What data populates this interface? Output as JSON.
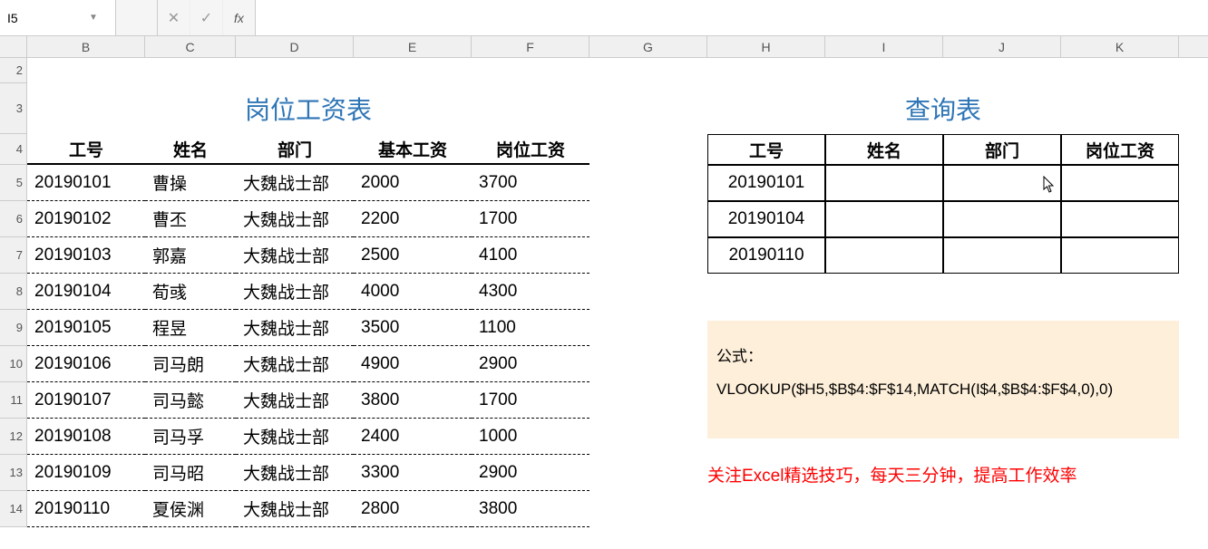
{
  "formula_bar": {
    "cell_ref": "I5",
    "cancel_icon": "✕",
    "confirm_icon": "✓",
    "fx_label": "fx",
    "formula_value": ""
  },
  "columns": [
    "B",
    "C",
    "D",
    "E",
    "F",
    "G",
    "H",
    "I",
    "J",
    "K"
  ],
  "col_widths": {
    "B": 130,
    "C": 100,
    "D": 130,
    "E": 130,
    "F": 130,
    "G": 130,
    "H": 130,
    "I": 130,
    "J": 130,
    "K": 130
  },
  "row_labels": [
    "2",
    "3",
    "4",
    "5",
    "6",
    "7",
    "8",
    "9",
    "10",
    "11",
    "12",
    "13",
    "14"
  ],
  "row_heights": {
    "2": 28,
    "3": 56,
    "4": 34,
    "5": 40,
    "6": 40,
    "7": 40,
    "8": 40,
    "9": 40,
    "10": 40,
    "11": 40,
    "12": 40,
    "13": 40,
    "14": 40
  },
  "left_table": {
    "title": "岗位工资表",
    "headers": [
      "工号",
      "姓名",
      "部门",
      "基本工资",
      "岗位工资"
    ],
    "rows": [
      {
        "id": "20190101",
        "name": "曹操",
        "dept": "大魏战士部",
        "base": "2000",
        "post": "3700"
      },
      {
        "id": "20190102",
        "name": "曹丕",
        "dept": "大魏战士部",
        "base": "2200",
        "post": "1700"
      },
      {
        "id": "20190103",
        "name": "郭嘉",
        "dept": "大魏战士部",
        "base": "2500",
        "post": "4100"
      },
      {
        "id": "20190104",
        "name": "荀彧",
        "dept": "大魏战士部",
        "base": "4000",
        "post": "4300"
      },
      {
        "id": "20190105",
        "name": "程昱",
        "dept": "大魏战士部",
        "base": "3500",
        "post": "1100"
      },
      {
        "id": "20190106",
        "name": "司马朗",
        "dept": "大魏战士部",
        "base": "4900",
        "post": "2900"
      },
      {
        "id": "20190107",
        "name": "司马懿",
        "dept": "大魏战士部",
        "base": "3800",
        "post": "1700"
      },
      {
        "id": "20190108",
        "name": "司马孚",
        "dept": "大魏战士部",
        "base": "2400",
        "post": "1000"
      },
      {
        "id": "20190109",
        "name": "司马昭",
        "dept": "大魏战士部",
        "base": "3300",
        "post": "2900"
      },
      {
        "id": "20190110",
        "name": "夏侯渊",
        "dept": "大魏战士部",
        "base": "2800",
        "post": "3800"
      }
    ]
  },
  "query_table": {
    "title": "查询表",
    "headers": [
      "工号",
      "姓名",
      "部门",
      "岗位工资"
    ],
    "rows": [
      {
        "id": "20190101",
        "name": "",
        "dept": "",
        "post": ""
      },
      {
        "id": "20190104",
        "name": "",
        "dept": "",
        "post": ""
      },
      {
        "id": "20190110",
        "name": "",
        "dept": "",
        "post": ""
      }
    ]
  },
  "formula_note": {
    "label": "公式：",
    "formula": "VLOOKUP($H5,$B$4:$F$14,MATCH(I$4,$B$4:$F$4,0),0)"
  },
  "footer_note": "关注Excel精选技巧，每天三分钟，提高工作效率"
}
